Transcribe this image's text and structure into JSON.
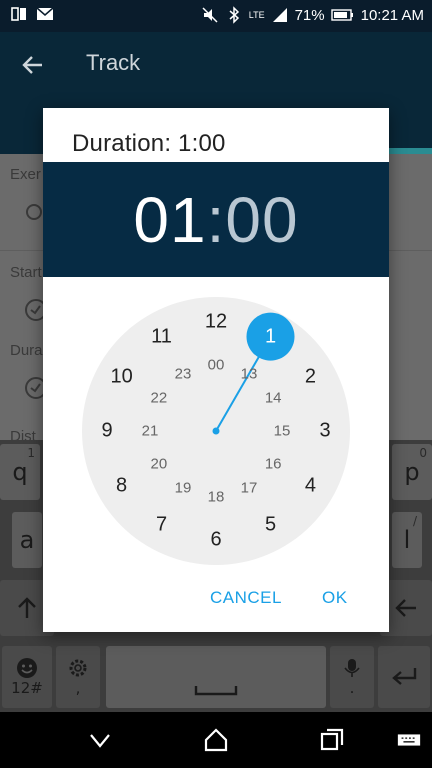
{
  "status_bar": {
    "battery_text": "71%",
    "time": "10:21 AM",
    "network_label": "LTE"
  },
  "app_bar": {
    "title": "Track"
  },
  "form": {
    "exercise_label": "Exer",
    "start_label": "Start",
    "duration_label": "Dura",
    "distance_label": "Dist"
  },
  "keyboard": {
    "row1": [
      {
        "key": "q",
        "sub": "1"
      },
      {
        "key": "p",
        "sub": "0"
      }
    ],
    "row2": [
      {
        "key": "a",
        "sub": ""
      },
      {
        "key": "l",
        "sub": "/"
      }
    ],
    "symbols_label": "12#",
    "comma_label": ",",
    "period_label": "."
  },
  "dialog": {
    "title": "Duration:  1:00",
    "hour": "01",
    "separator": ":",
    "minute": "00",
    "cancel_label": "CANCEL",
    "ok_label": "OK",
    "selected_value": "1",
    "outer_numbers": [
      "12",
      "1",
      "2",
      "3",
      "4",
      "5",
      "6",
      "7",
      "8",
      "9",
      "10",
      "11"
    ],
    "inner_numbers": [
      "00",
      "13",
      "14",
      "15",
      "16",
      "17",
      "18",
      "19",
      "20",
      "21",
      "22",
      "23"
    ]
  },
  "colors": {
    "accent": "#1aa0e6",
    "header_bg": "#062b44",
    "clock_face": "#eeeeee",
    "app_bar": "#092738"
  },
  "icons": {
    "back": "arrow-left-icon",
    "nav_back": "chevron-down-icon",
    "nav_home": "home-icon",
    "nav_recents": "recents-icon",
    "keyboard": "keyboard-icon"
  }
}
